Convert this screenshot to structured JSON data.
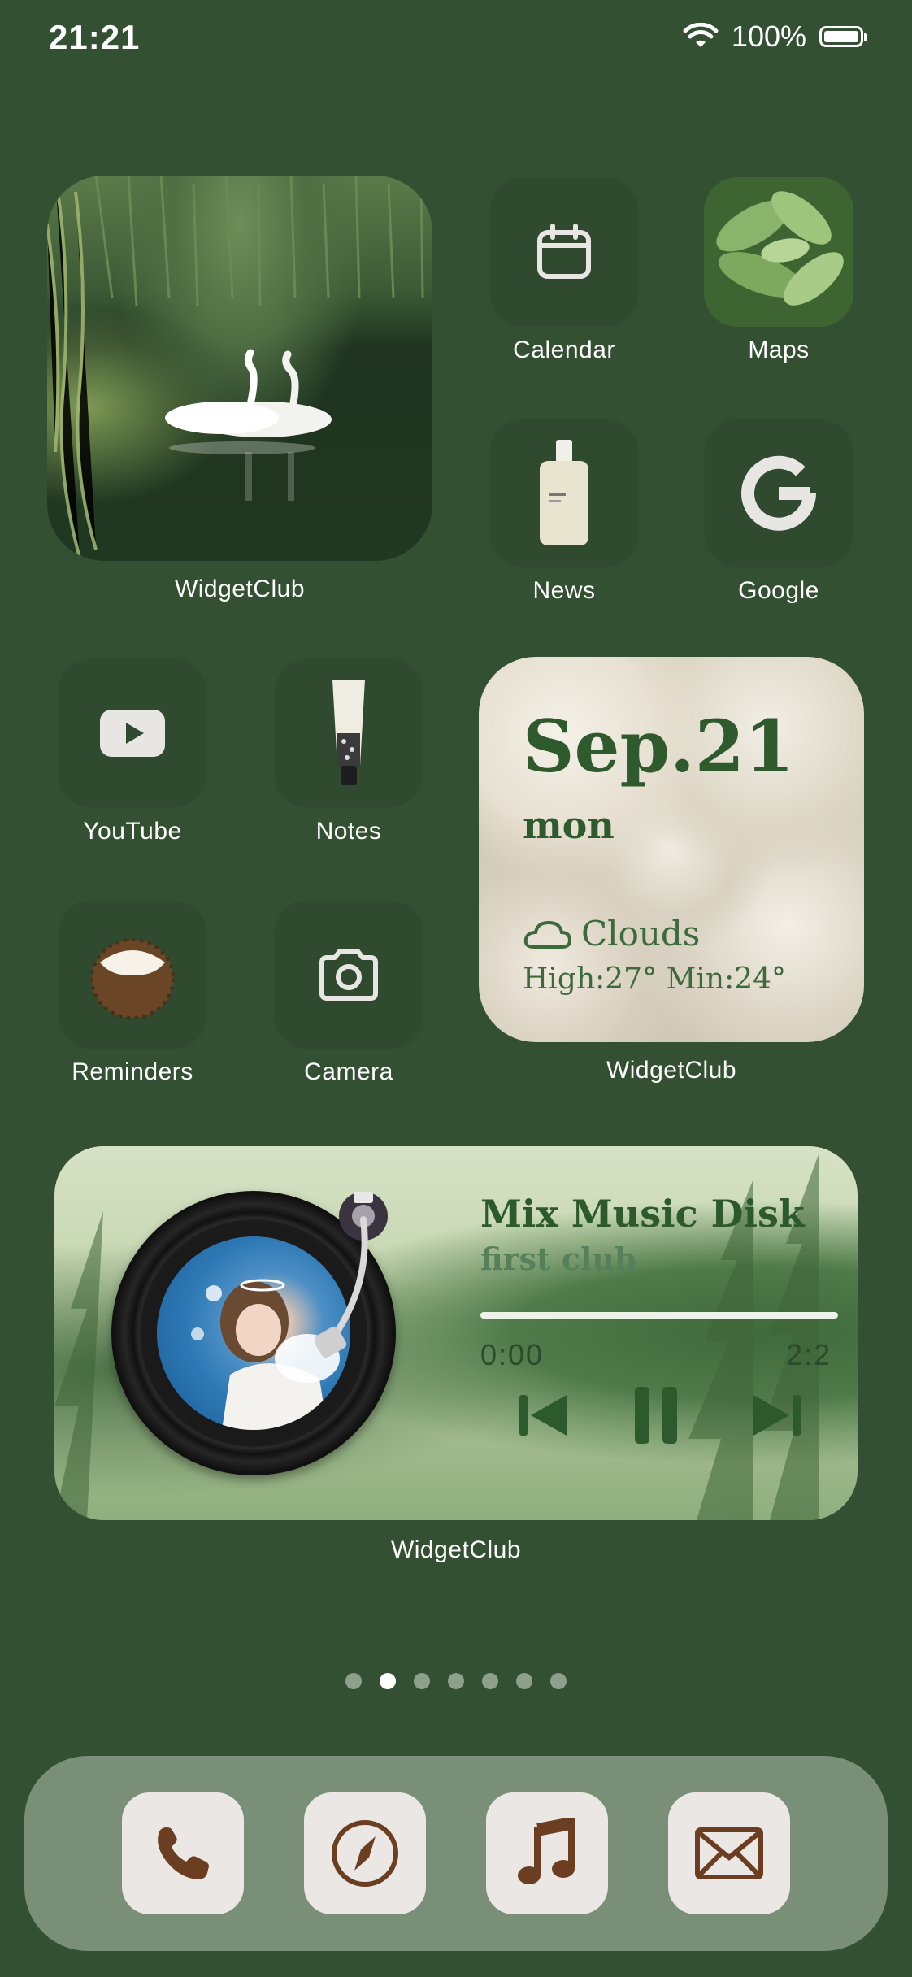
{
  "status_bar": {
    "time": "21:21",
    "battery": "100%"
  },
  "widgets": {
    "photo": {
      "label": "WidgetClub"
    },
    "calendar_weather": {
      "date": "Sep.21",
      "day": "mon",
      "weather": "Clouds",
      "temps": "High:27° Min:24°",
      "label": "WidgetClub"
    },
    "music": {
      "title": "Mix Music Disk",
      "subtitle": "first club",
      "time_start": "0:00",
      "time_end": "2:2",
      "progress": 0.0,
      "label": "WidgetClub"
    }
  },
  "apps": {
    "calendar": "Calendar",
    "maps": "Maps",
    "news": "News",
    "google": "Google",
    "youtube": "YouTube",
    "notes": "Notes",
    "reminders": "Reminders",
    "camera": "Camera"
  },
  "pages": {
    "count": 7,
    "active_index": 1
  },
  "dock": {
    "items": [
      "phone-icon",
      "compass-icon",
      "music-note-icon",
      "mail-icon"
    ]
  },
  "colors": {
    "background": "#345033",
    "tile": "#2f4a2e",
    "dock": "#7a8f78",
    "dock_icon_glyph": "#6b3e22"
  }
}
